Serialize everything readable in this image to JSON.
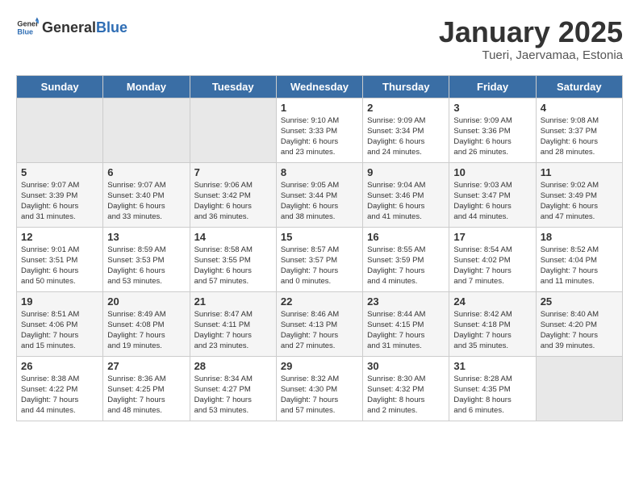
{
  "header": {
    "logo_general": "General",
    "logo_blue": "Blue",
    "calendar_title": "January 2025",
    "calendar_subtitle": "Tueri, Jaervamaa, Estonia"
  },
  "days_of_week": [
    "Sunday",
    "Monday",
    "Tuesday",
    "Wednesday",
    "Thursday",
    "Friday",
    "Saturday"
  ],
  "weeks": [
    [
      {
        "day": "",
        "info": ""
      },
      {
        "day": "",
        "info": ""
      },
      {
        "day": "",
        "info": ""
      },
      {
        "day": "1",
        "info": "Sunrise: 9:10 AM\nSunset: 3:33 PM\nDaylight: 6 hours\nand 23 minutes."
      },
      {
        "day": "2",
        "info": "Sunrise: 9:09 AM\nSunset: 3:34 PM\nDaylight: 6 hours\nand 24 minutes."
      },
      {
        "day": "3",
        "info": "Sunrise: 9:09 AM\nSunset: 3:36 PM\nDaylight: 6 hours\nand 26 minutes."
      },
      {
        "day": "4",
        "info": "Sunrise: 9:08 AM\nSunset: 3:37 PM\nDaylight: 6 hours\nand 28 minutes."
      }
    ],
    [
      {
        "day": "5",
        "info": "Sunrise: 9:07 AM\nSunset: 3:39 PM\nDaylight: 6 hours\nand 31 minutes."
      },
      {
        "day": "6",
        "info": "Sunrise: 9:07 AM\nSunset: 3:40 PM\nDaylight: 6 hours\nand 33 minutes."
      },
      {
        "day": "7",
        "info": "Sunrise: 9:06 AM\nSunset: 3:42 PM\nDaylight: 6 hours\nand 36 minutes."
      },
      {
        "day": "8",
        "info": "Sunrise: 9:05 AM\nSunset: 3:44 PM\nDaylight: 6 hours\nand 38 minutes."
      },
      {
        "day": "9",
        "info": "Sunrise: 9:04 AM\nSunset: 3:46 PM\nDaylight: 6 hours\nand 41 minutes."
      },
      {
        "day": "10",
        "info": "Sunrise: 9:03 AM\nSunset: 3:47 PM\nDaylight: 6 hours\nand 44 minutes."
      },
      {
        "day": "11",
        "info": "Sunrise: 9:02 AM\nSunset: 3:49 PM\nDaylight: 6 hours\nand 47 minutes."
      }
    ],
    [
      {
        "day": "12",
        "info": "Sunrise: 9:01 AM\nSunset: 3:51 PM\nDaylight: 6 hours\nand 50 minutes."
      },
      {
        "day": "13",
        "info": "Sunrise: 8:59 AM\nSunset: 3:53 PM\nDaylight: 6 hours\nand 53 minutes."
      },
      {
        "day": "14",
        "info": "Sunrise: 8:58 AM\nSunset: 3:55 PM\nDaylight: 6 hours\nand 57 minutes."
      },
      {
        "day": "15",
        "info": "Sunrise: 8:57 AM\nSunset: 3:57 PM\nDaylight: 7 hours\nand 0 minutes."
      },
      {
        "day": "16",
        "info": "Sunrise: 8:55 AM\nSunset: 3:59 PM\nDaylight: 7 hours\nand 4 minutes."
      },
      {
        "day": "17",
        "info": "Sunrise: 8:54 AM\nSunset: 4:02 PM\nDaylight: 7 hours\nand 7 minutes."
      },
      {
        "day": "18",
        "info": "Sunrise: 8:52 AM\nSunset: 4:04 PM\nDaylight: 7 hours\nand 11 minutes."
      }
    ],
    [
      {
        "day": "19",
        "info": "Sunrise: 8:51 AM\nSunset: 4:06 PM\nDaylight: 7 hours\nand 15 minutes."
      },
      {
        "day": "20",
        "info": "Sunrise: 8:49 AM\nSunset: 4:08 PM\nDaylight: 7 hours\nand 19 minutes."
      },
      {
        "day": "21",
        "info": "Sunrise: 8:47 AM\nSunset: 4:11 PM\nDaylight: 7 hours\nand 23 minutes."
      },
      {
        "day": "22",
        "info": "Sunrise: 8:46 AM\nSunset: 4:13 PM\nDaylight: 7 hours\nand 27 minutes."
      },
      {
        "day": "23",
        "info": "Sunrise: 8:44 AM\nSunset: 4:15 PM\nDaylight: 7 hours\nand 31 minutes."
      },
      {
        "day": "24",
        "info": "Sunrise: 8:42 AM\nSunset: 4:18 PM\nDaylight: 7 hours\nand 35 minutes."
      },
      {
        "day": "25",
        "info": "Sunrise: 8:40 AM\nSunset: 4:20 PM\nDaylight: 7 hours\nand 39 minutes."
      }
    ],
    [
      {
        "day": "26",
        "info": "Sunrise: 8:38 AM\nSunset: 4:22 PM\nDaylight: 7 hours\nand 44 minutes."
      },
      {
        "day": "27",
        "info": "Sunrise: 8:36 AM\nSunset: 4:25 PM\nDaylight: 7 hours\nand 48 minutes."
      },
      {
        "day": "28",
        "info": "Sunrise: 8:34 AM\nSunset: 4:27 PM\nDaylight: 7 hours\nand 53 minutes."
      },
      {
        "day": "29",
        "info": "Sunrise: 8:32 AM\nSunset: 4:30 PM\nDaylight: 7 hours\nand 57 minutes."
      },
      {
        "day": "30",
        "info": "Sunrise: 8:30 AM\nSunset: 4:32 PM\nDaylight: 8 hours\nand 2 minutes."
      },
      {
        "day": "31",
        "info": "Sunrise: 8:28 AM\nSunset: 4:35 PM\nDaylight: 8 hours\nand 6 minutes."
      },
      {
        "day": "",
        "info": ""
      }
    ]
  ]
}
